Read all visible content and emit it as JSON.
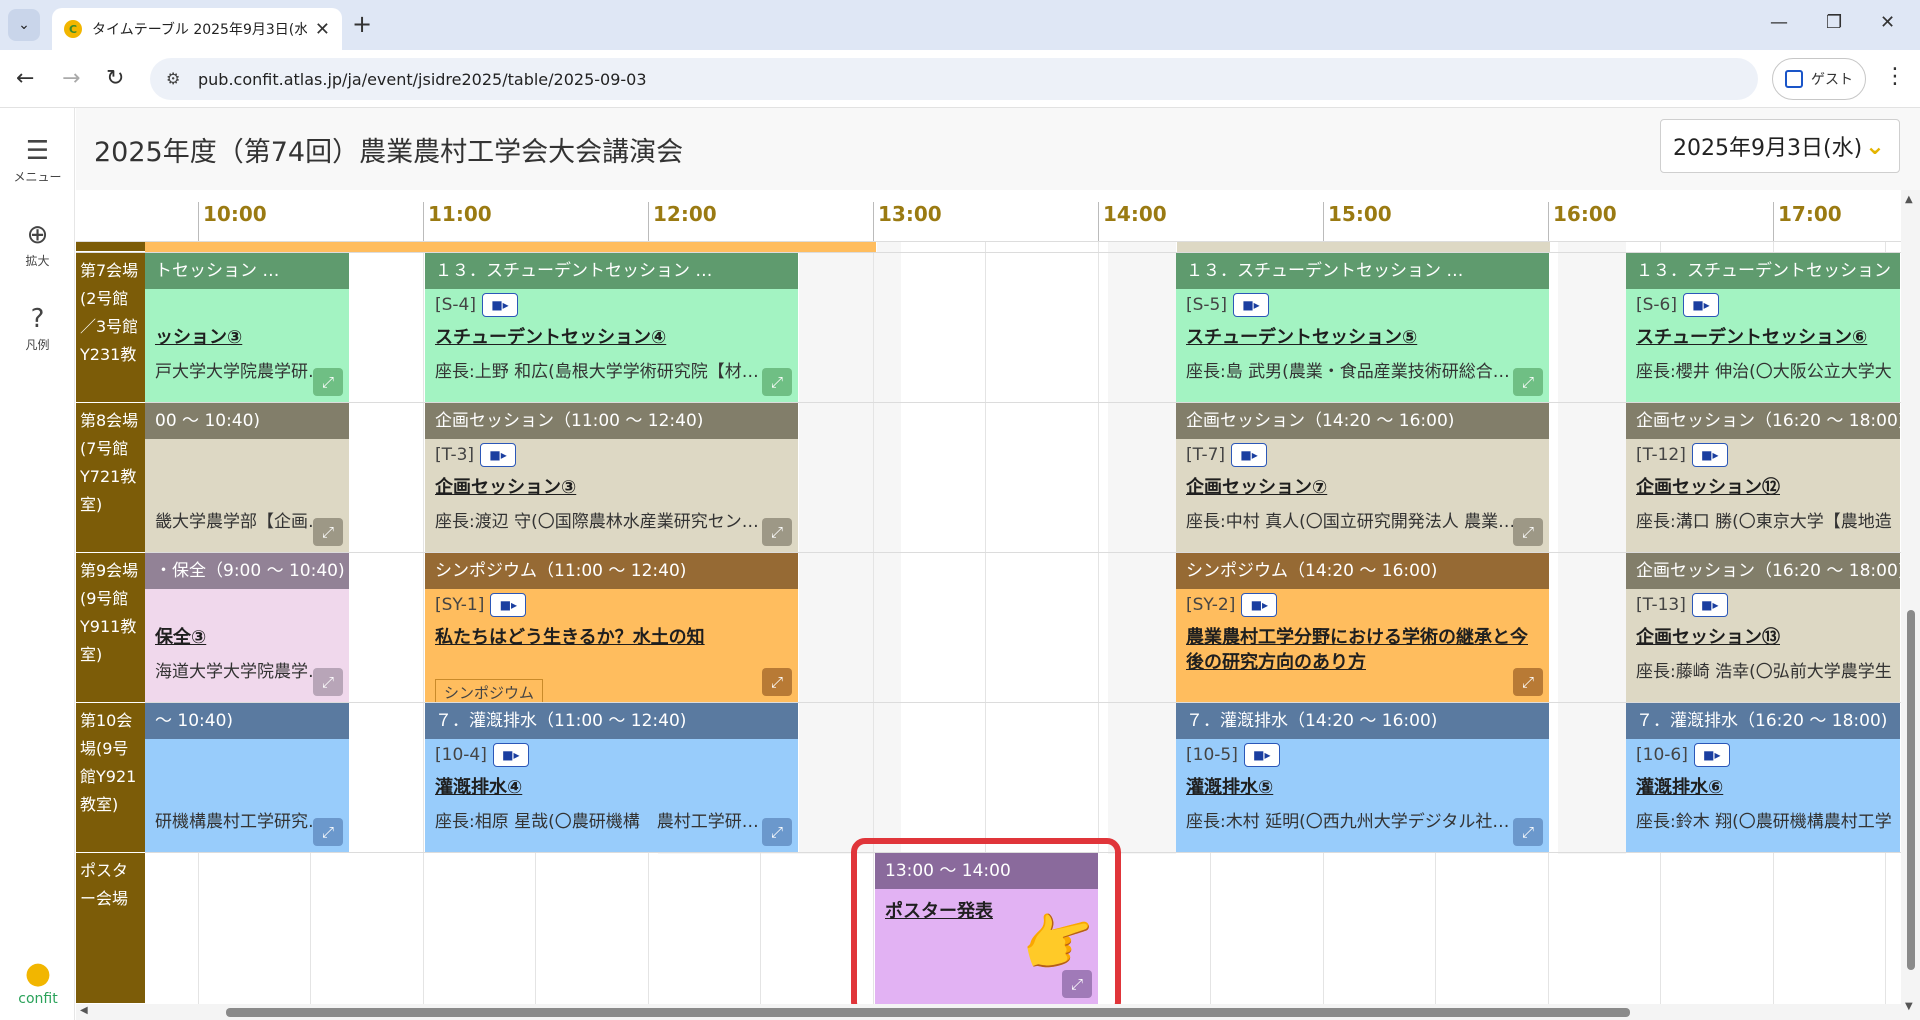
{
  "browser": {
    "tab_title": "タイムテーブル 2025年9月3日(水) | ...",
    "url": "pub.confit.atlas.jp/ja/event/jsidre2025/table/2025-09-03",
    "guest_label": "ゲスト"
  },
  "sidebar": {
    "menu": "メニュー",
    "zoom": "拡大",
    "legend": "凡例",
    "logo": "confit"
  },
  "header": {
    "title": "2025年度（第74回）農業農村工学会大会講演会",
    "date_selected": "2025年9月3日(水)"
  },
  "hours": [
    "10:00",
    "11:00",
    "12:00",
    "13:00",
    "14:00",
    "15:00",
    "16:00",
    "17:00"
  ],
  "rooms": [
    {
      "label": "第7会場(2号館／3号館Y231教"
    },
    {
      "label": "第8会場(7号館Y721教室)"
    },
    {
      "label": "第9会場(9号館Y911教室)"
    },
    {
      "label": "第10会場(9号館Y921教室)"
    },
    {
      "label": "ポスター会場"
    }
  ],
  "sessions": {
    "r7a": {
      "header": "トセッション …",
      "title": "ッション③",
      "chair": "戸大学大学院農学研…"
    },
    "r7b": {
      "header": "１３．スチューデントセッション …",
      "code": "[S-4]",
      "title": "スチューデントセッション④",
      "chair": "座長:上野 和広(島根大学学術研究院【材…"
    },
    "r7c": {
      "header": "１３．スチューデントセッション …",
      "code": "[S-5]",
      "title": "スチューデントセッション⑤",
      "chair": "座長:島 武男(農業・食品産業技術研総合…"
    },
    "r7d": {
      "header": "１３．スチューデントセッション",
      "code": "[S-6]",
      "title": "スチューデントセッション⑥",
      "chair": "座長:櫻井 伸治(〇大阪公立大学大"
    },
    "r8a": {
      "header": "00 〜 10:40)",
      "chair": "畿大学農学部【企画…"
    },
    "r8b": {
      "header": "企画セッション（11:00 〜 12:40)",
      "code": "[T-3]",
      "title": "企画セッション③",
      "chair": "座長:渡辺 守(〇国際農林水産業研究セン…"
    },
    "r8c": {
      "header": "企画セッション（14:20 〜 16:00)",
      "code": "[T-7]",
      "title": "企画セッション⑦",
      "chair": "座長:中村 真人(〇国立研究開発法人 農業…"
    },
    "r8d": {
      "header": "企画セッション（16:20 〜 18:00)",
      "code": "[T-12]",
      "title": "企画セッション⑫",
      "chair": "座長:溝口 勝(〇東京大学【農地造"
    },
    "r9a": {
      "header": "・保全（9:00 〜 10:40)",
      "title": "保全③",
      "chair": "海道大学大学院農学…"
    },
    "r9b": {
      "header": "シンポジウム（11:00 〜 12:40)",
      "code": "[SY-1]",
      "title": "私たちはどう生きるか？水土の知",
      "tag": "シンポジウム"
    },
    "r9c": {
      "header": "シンポジウム（14:20 〜 16:00)",
      "code": "[SY-2]",
      "title": "農業農村工学分野における学術の継承と今後の研究方向のあり方"
    },
    "r9d": {
      "header": "企画セッション（16:20 〜 18:00)",
      "code": "[T-13]",
      "title": "企画セッション⑬",
      "chair": "座長:藤崎 浩幸(〇弘前大学農学生"
    },
    "r10a": {
      "header": "〜 10:40)",
      "chair": "研機構農村工学研究…"
    },
    "r10b": {
      "header": "７．灌漑排水（11:00 〜 12:40)",
      "code": "[10-4]",
      "title": "灌漑排水④",
      "chair": "座長:相原 星哉(〇農研機構　農村工学研…"
    },
    "r10c": {
      "header": "７．灌漑排水（14:20 〜 16:00)",
      "code": "[10-5]",
      "title": "灌漑排水⑤",
      "chair": "座長:木村 延明(〇西九州大学デジタル社…"
    },
    "r10d": {
      "header": "７．灌漑排水（16:20 〜 18:00)",
      "code": "[10-6]",
      "title": "灌漑排水⑥",
      "chair": "座長:鈴木 翔(〇農研機構農村工学"
    },
    "poster": {
      "header": "13:00 〜 14:00",
      "title": "ポスター発表"
    }
  }
}
